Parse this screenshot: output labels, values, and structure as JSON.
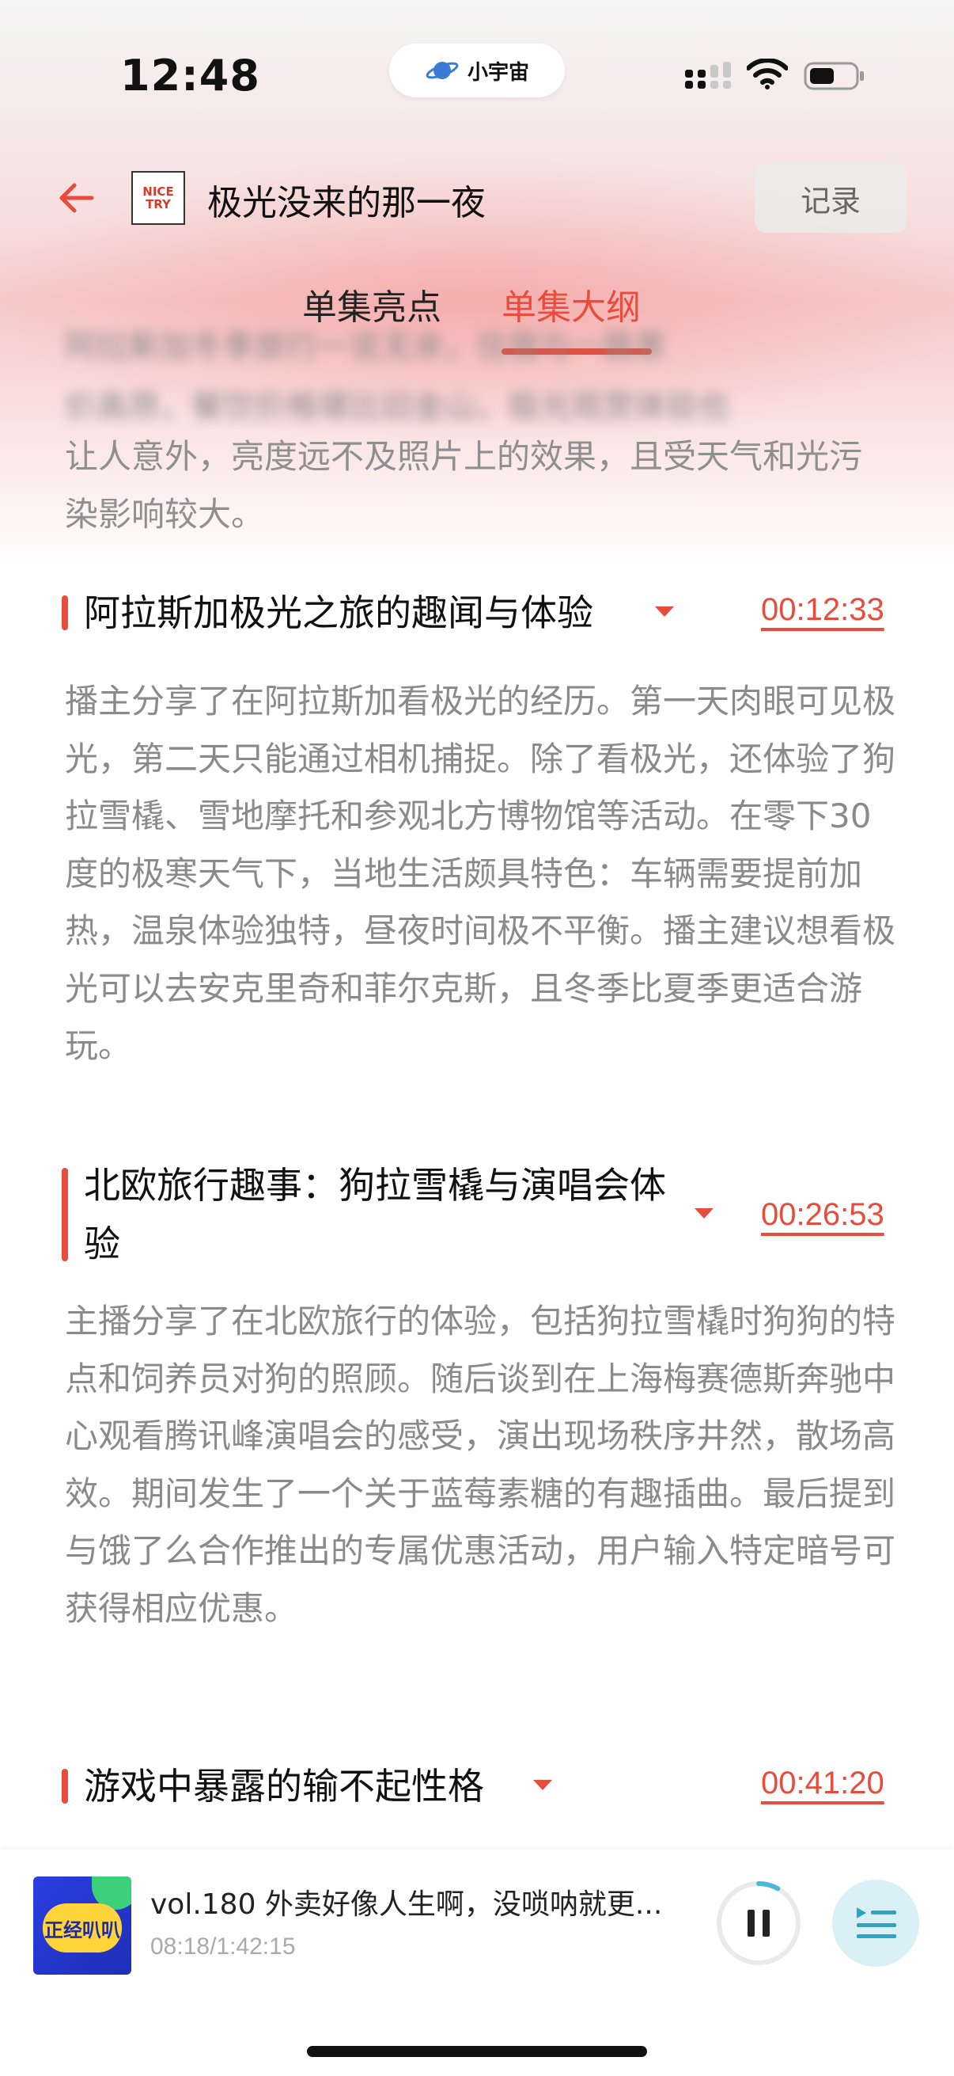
{
  "status_bar": {
    "time": "12:48",
    "island_label": "小宇宙"
  },
  "header": {
    "podcast_logo_text": "NICE\nTRY",
    "episode_title": "极光没来的那一夜",
    "record_label": "记录"
  },
  "tabs": [
    {
      "label": "单集亮点",
      "active": false
    },
    {
      "label": "单集大纲",
      "active": true
    }
  ],
  "intro": {
    "blurred_lines": [
      "阿拉斯加冬季旅行一览无余，住宿与一路景",
      "价高昂，餐饮价格堪比旧金山，极光观赏体验也"
    ],
    "visible_text": "让人意外，亮度远不及照片上的效果，且受天气和光污染影响较大。"
  },
  "sections": [
    {
      "title": "阿拉斯加极光之旅的趣闻与体验",
      "timestamp": "00:12:33",
      "body": "播主分享了在阿拉斯加看极光的经历。第一天肉眼可见极光，第二天只能通过相机捕捉。除了看极光，还体验了狗拉雪橇、雪地摩托和参观北方博物馆等活动。在零下30度的极寒天气下，当地生活颇具特色：车辆需要提前加热，温泉体验独特，昼夜时间极不平衡。播主建议想看极光可以去安克里奇和菲尔克斯，且冬季比夏季更适合游玩。"
    },
    {
      "title": "北欧旅行趣事：狗拉雪橇与演唱会体验",
      "timestamp": "00:26:53",
      "body": "主播分享了在北欧旅行的体验，包括狗拉雪橇时狗狗的特点和饲养员对狗的照顾。随后谈到在上海梅赛德斯奔驰中心观看腾讯峰演唱会的感受，演出现场秩序井然，散场高效。期间发生了一个关于蓝莓素糖的有趣插曲。最后提到与饿了么合作推出的专属优惠活动，用户输入特定暗号可获得相应优惠。"
    },
    {
      "title": "游戏中暴露的输不起性格",
      "timestamp": "00:41:20",
      "body": ""
    }
  ],
  "player": {
    "cover_text": "正经叭叭",
    "title": "vol.180 外卖好像人生啊，没唢呐就更...",
    "progress": "08:18/1:42:15",
    "progress_fraction": 0.081
  },
  "colors": {
    "accent": "#e84c3d",
    "body_text": "#8a8a8a",
    "list_button_bg": "#d9f0f6"
  }
}
